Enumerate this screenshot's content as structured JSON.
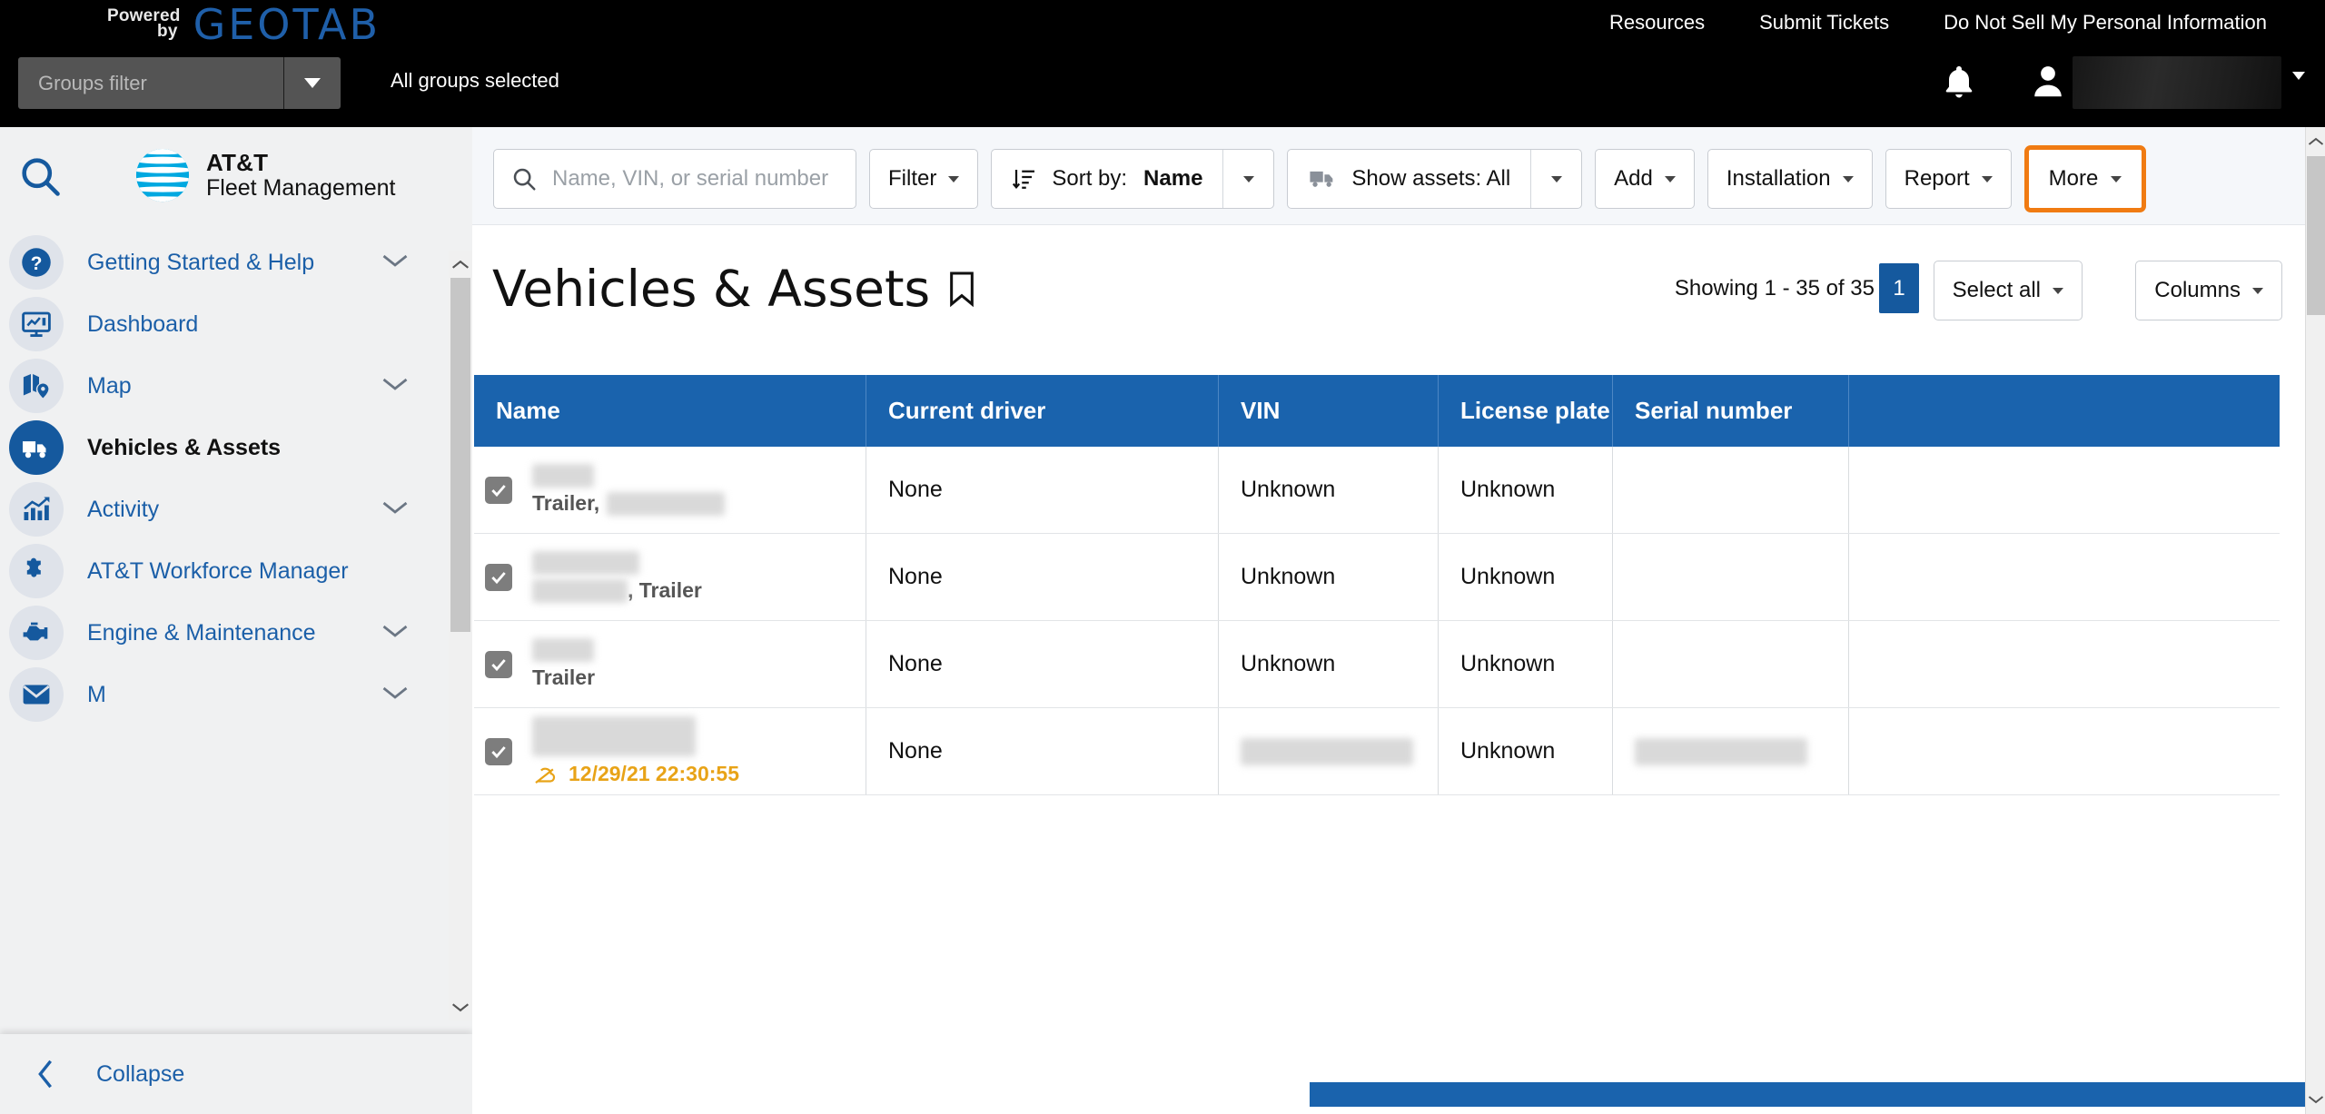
{
  "topbar": {
    "powered_line1": "Powered",
    "powered_line2": "by",
    "geotab": "GEOTAB",
    "links": [
      {
        "label": "Resources"
      },
      {
        "label": "Submit Tickets"
      },
      {
        "label": "Do Not Sell My Personal Information"
      }
    ],
    "groups_filter_placeholder": "Groups filter",
    "all_groups_selected": "All groups selected",
    "username_redacted": ""
  },
  "sidebar": {
    "logo_line1": "AT&T",
    "logo_line2": "Fleet Management",
    "collapse_label": "Collapse",
    "items": [
      {
        "label": "Getting Started & Help",
        "icon": "help-circle-icon",
        "chevron": true,
        "active": false
      },
      {
        "label": "Dashboard",
        "icon": "monitor-chart-icon",
        "chevron": false,
        "active": false
      },
      {
        "label": "Map",
        "icon": "map-pin-icon",
        "chevron": true,
        "active": false
      },
      {
        "label": "Vehicles & Assets",
        "icon": "truck-icon",
        "chevron": false,
        "active": true
      },
      {
        "label": "Activity",
        "icon": "bar-chart-icon",
        "chevron": true,
        "active": false
      },
      {
        "label": "AT&T Workforce Manager",
        "icon": "puzzle-icon",
        "chevron": false,
        "active": false
      },
      {
        "label": "Engine & Maintenance",
        "icon": "engine-icon",
        "chevron": true,
        "active": false
      },
      {
        "label": "M",
        "icon": "messages-icon",
        "chevron": true,
        "active": false
      }
    ]
  },
  "toolbar": {
    "search_placeholder": "Name, VIN, or serial number",
    "search_value": "",
    "filter_label": "Filter",
    "sort_prefix": "Sort by:",
    "sort_value": "Name",
    "show_assets_label": "Show assets: All",
    "add_label": "Add",
    "installation_label": "Installation",
    "report_label": "Report",
    "more_label": "More",
    "more_highlight_color": "#f07b12"
  },
  "page": {
    "title": "Vehicles & Assets",
    "showing": "Showing 1 - 35 of 35",
    "page_number": "1",
    "select_all_label": "Select all",
    "columns_label": "Columns"
  },
  "table": {
    "columns": [
      "Name",
      "Current driver",
      "VIN",
      "License plate",
      "Serial number"
    ],
    "rows": [
      {
        "checked": true,
        "name_redacted": true,
        "name_sub": "Trailer,",
        "sub_redacted": true,
        "current_driver": "None",
        "vin": "Unknown",
        "license_plate": "Unknown",
        "serial_number": "",
        "serial_redacted": false,
        "vin_redacted": false,
        "stale_timestamp": ""
      },
      {
        "checked": true,
        "name_redacted": true,
        "name_sub": ", Trailer",
        "sub_redacted": false,
        "current_driver": "None",
        "vin": "Unknown",
        "license_plate": "Unknown",
        "serial_number": "",
        "serial_redacted": false,
        "vin_redacted": false,
        "stale_timestamp": ""
      },
      {
        "checked": true,
        "name_redacted": true,
        "name_sub": "Trailer",
        "sub_redacted": false,
        "current_driver": "None",
        "vin": "Unknown",
        "license_plate": "Unknown",
        "serial_number": "",
        "serial_redacted": false,
        "vin_redacted": false,
        "stale_timestamp": ""
      },
      {
        "checked": true,
        "name_redacted": true,
        "name_sub": "",
        "sub_redacted": false,
        "current_driver": "None",
        "vin": "",
        "license_plate": "Unknown",
        "serial_number": "",
        "serial_redacted": true,
        "vin_redacted": true,
        "stale_timestamp": "12/29/21 22:30:55"
      }
    ]
  },
  "colors": {
    "brand_blue": "#15599e",
    "table_header_blue": "#1a63ad",
    "highlight_orange": "#f07b12",
    "stale_amber": "#e8a317",
    "topbar_black": "#000000"
  }
}
